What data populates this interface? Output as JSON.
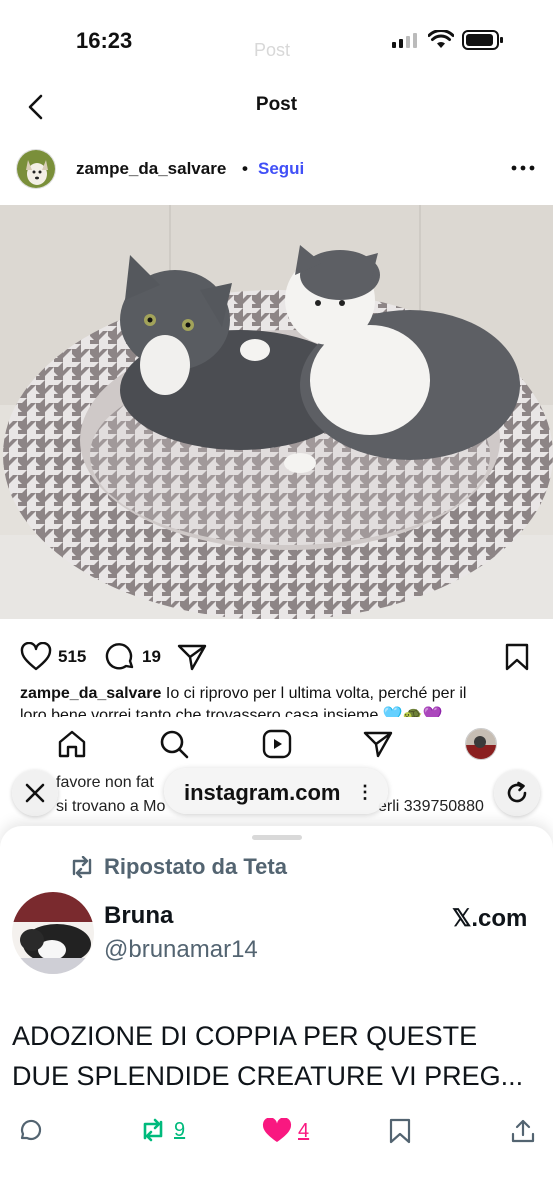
{
  "status": {
    "time": "16:23",
    "ghost_title": "Post"
  },
  "header": {
    "title": "Post"
  },
  "post": {
    "username": "zampe_da_salvare",
    "separator": "•",
    "follow_label": "Segui",
    "likes": "515",
    "comments": "19",
    "caption_user": "zampe_da_salvare",
    "caption_line1": "Io ci riprovo per l ultima volta, perché per il",
    "caption_line2": "loro bene vorrei tanto che trovassero casa insieme 🩵🐢💜"
  },
  "behind_text": {
    "line1_left": "favore non fat",
    "line2_left": "si trovano a Mo",
    "line2_right": "erli 339750880"
  },
  "browser": {
    "url": "instagram.com",
    "menu": "⋮"
  },
  "x_card": {
    "repost_label": "Ripostato da Teta",
    "name": "Bruna",
    "handle": "@brunamar14",
    "brand": "𝕏.com",
    "text": "ADOZIONE DI COPPIA PER QUESTE DUE SPLENDIDE CREATURE VI PREG...",
    "reposts": "9",
    "likes": "4"
  },
  "colors": {
    "accent_follow": "#4150f7",
    "repost_green": "#00ba7c",
    "like_pink": "#f91880",
    "x_gray": "#536471"
  },
  "icons": [
    "back-chevron-icon",
    "more-icon",
    "heart-icon",
    "comment-icon",
    "share-icon",
    "bookmark-icon",
    "home-icon",
    "search-icon",
    "reels-icon",
    "direct-icon",
    "profile-icon",
    "close-icon",
    "reload-icon",
    "repost-icon",
    "reply-icon",
    "like-icon",
    "x-bookmark-icon",
    "x-share-icon"
  ]
}
